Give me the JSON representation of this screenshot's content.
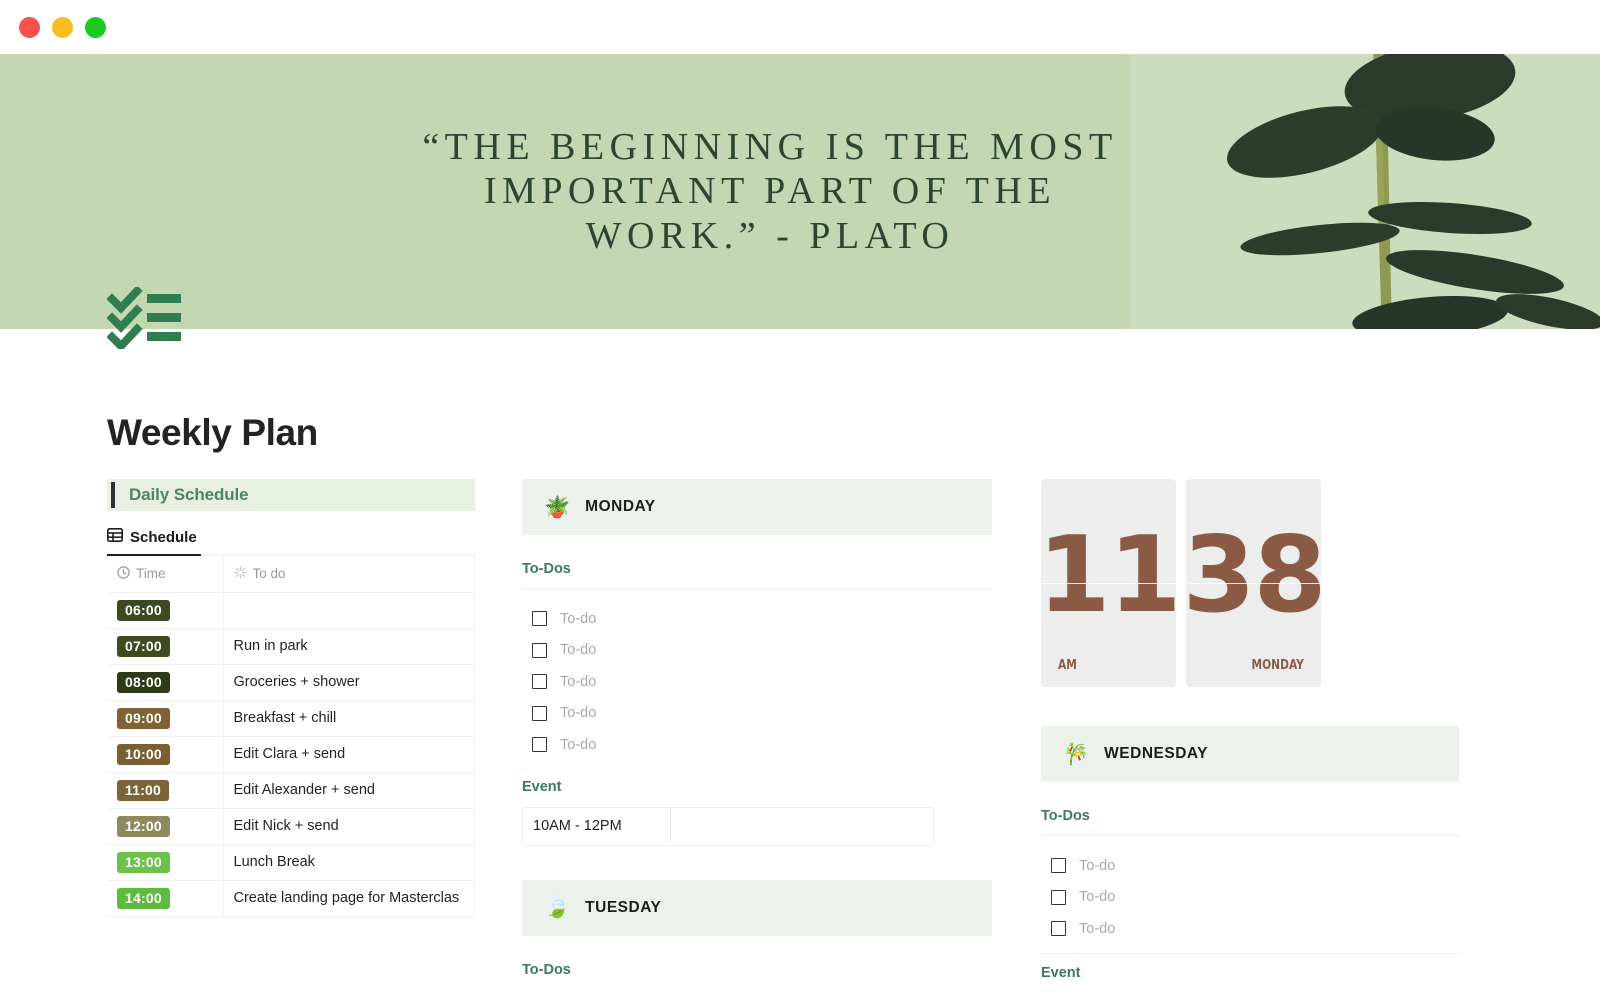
{
  "window": {
    "buttons": [
      {
        "name": "close",
        "color": "#f9524e"
      },
      {
        "name": "minimize",
        "color": "#f9bd1d"
      },
      {
        "name": "maximize",
        "color": "#1ec81e"
      }
    ]
  },
  "banner": {
    "quote": "“The beginning is the most important part of the work.” - Plato",
    "background_color": "#c3d8b2",
    "text_color": "#2b4530",
    "photo_description": "eucalyptus-sprig"
  },
  "logo": {
    "icon": "checklist-icon",
    "color": "#2f7d51"
  },
  "page": {
    "title": "Weekly Plan"
  },
  "left_column": {
    "callout": {
      "label": "Daily Schedule",
      "accent_color": "#4d8466"
    },
    "database": {
      "tab_label": "Schedule",
      "tab_icon": "table-icon",
      "columns": [
        {
          "label": "Time",
          "icon": "clock-icon"
        },
        {
          "label": "To do",
          "icon": "sparkle-icon"
        }
      ],
      "rows": [
        {
          "time": "06:00",
          "color": "#3d4a21",
          "todo": ""
        },
        {
          "time": "07:00",
          "color": "#3f4a1f",
          "todo": "Run in park"
        },
        {
          "time": "08:00",
          "color": "#2f3a16",
          "todo": "Groceries + shower"
        },
        {
          "time": "09:00",
          "color": "#7e6134",
          "todo": "Breakfast + chill"
        },
        {
          "time": "10:00",
          "color": "#7a5f33",
          "todo": "Edit Clara + send"
        },
        {
          "time": "11:00",
          "color": "#7d6338",
          "todo": "Edit Alexander + send"
        },
        {
          "time": "12:00",
          "color": "#8f8a5e",
          "todo": "Edit Nick + send"
        },
        {
          "time": "13:00",
          "color": "#6cc249",
          "todo": "Lunch Break"
        },
        {
          "time": "14:00",
          "color": "#5fbb3c",
          "todo": "Create landing page for Masterclas"
        }
      ]
    }
  },
  "middle_column": {
    "days": [
      {
        "name": "MONDAY",
        "emoji": "🪴",
        "emoji_name": "potted-plant-icon",
        "todos_label": "To-Dos",
        "todos": [
          "To-do",
          "To-do",
          "To-do",
          "To-do",
          "To-do"
        ],
        "event_label": "Event",
        "event": {
          "time": "10AM - 12PM",
          "note": ""
        }
      },
      {
        "name": "TUESDAY",
        "emoji": "🍃",
        "emoji_name": "leaf-icon",
        "todos_label": "To-Dos"
      }
    ]
  },
  "right_column": {
    "clock": {
      "hours": "11",
      "minutes": "38",
      "meridiem": "AM",
      "weekday": "MONDAY",
      "digit_color": "#8a5a44",
      "card_color": "#ededed"
    },
    "day": {
      "name": "WEDNESDAY",
      "emoji": "🎋",
      "emoji_name": "tanabata-tree-icon",
      "todos_label": "To-Dos",
      "todos": [
        "To-do",
        "To-do",
        "To-do"
      ],
      "event_label": "Event"
    }
  }
}
